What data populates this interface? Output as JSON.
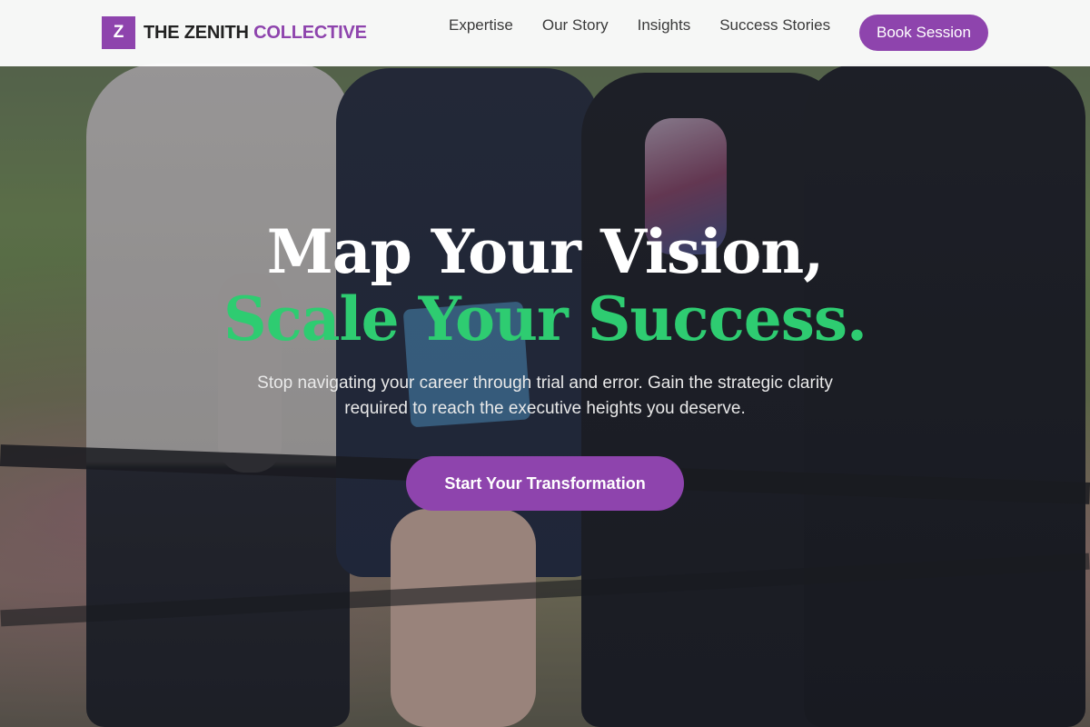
{
  "brand": {
    "mark": "Z",
    "name_primary": "THE ZENITH",
    "name_accent": "COLLECTIVE"
  },
  "nav": {
    "links": [
      "Expertise",
      "Our Story",
      "Insights",
      "Success Stories"
    ],
    "cta_label": "Book Session"
  },
  "hero": {
    "headline_line1": "Map Your Vision,",
    "headline_line2": "Scale Your Success.",
    "subtext": "Stop navigating your career through trial and error. Gain the strategic clarity required to reach the executive heights you deserve.",
    "cta_label": "Start Your Transformation"
  },
  "colors": {
    "accent": "#8e44ad",
    "highlight": "#2ecc71"
  }
}
